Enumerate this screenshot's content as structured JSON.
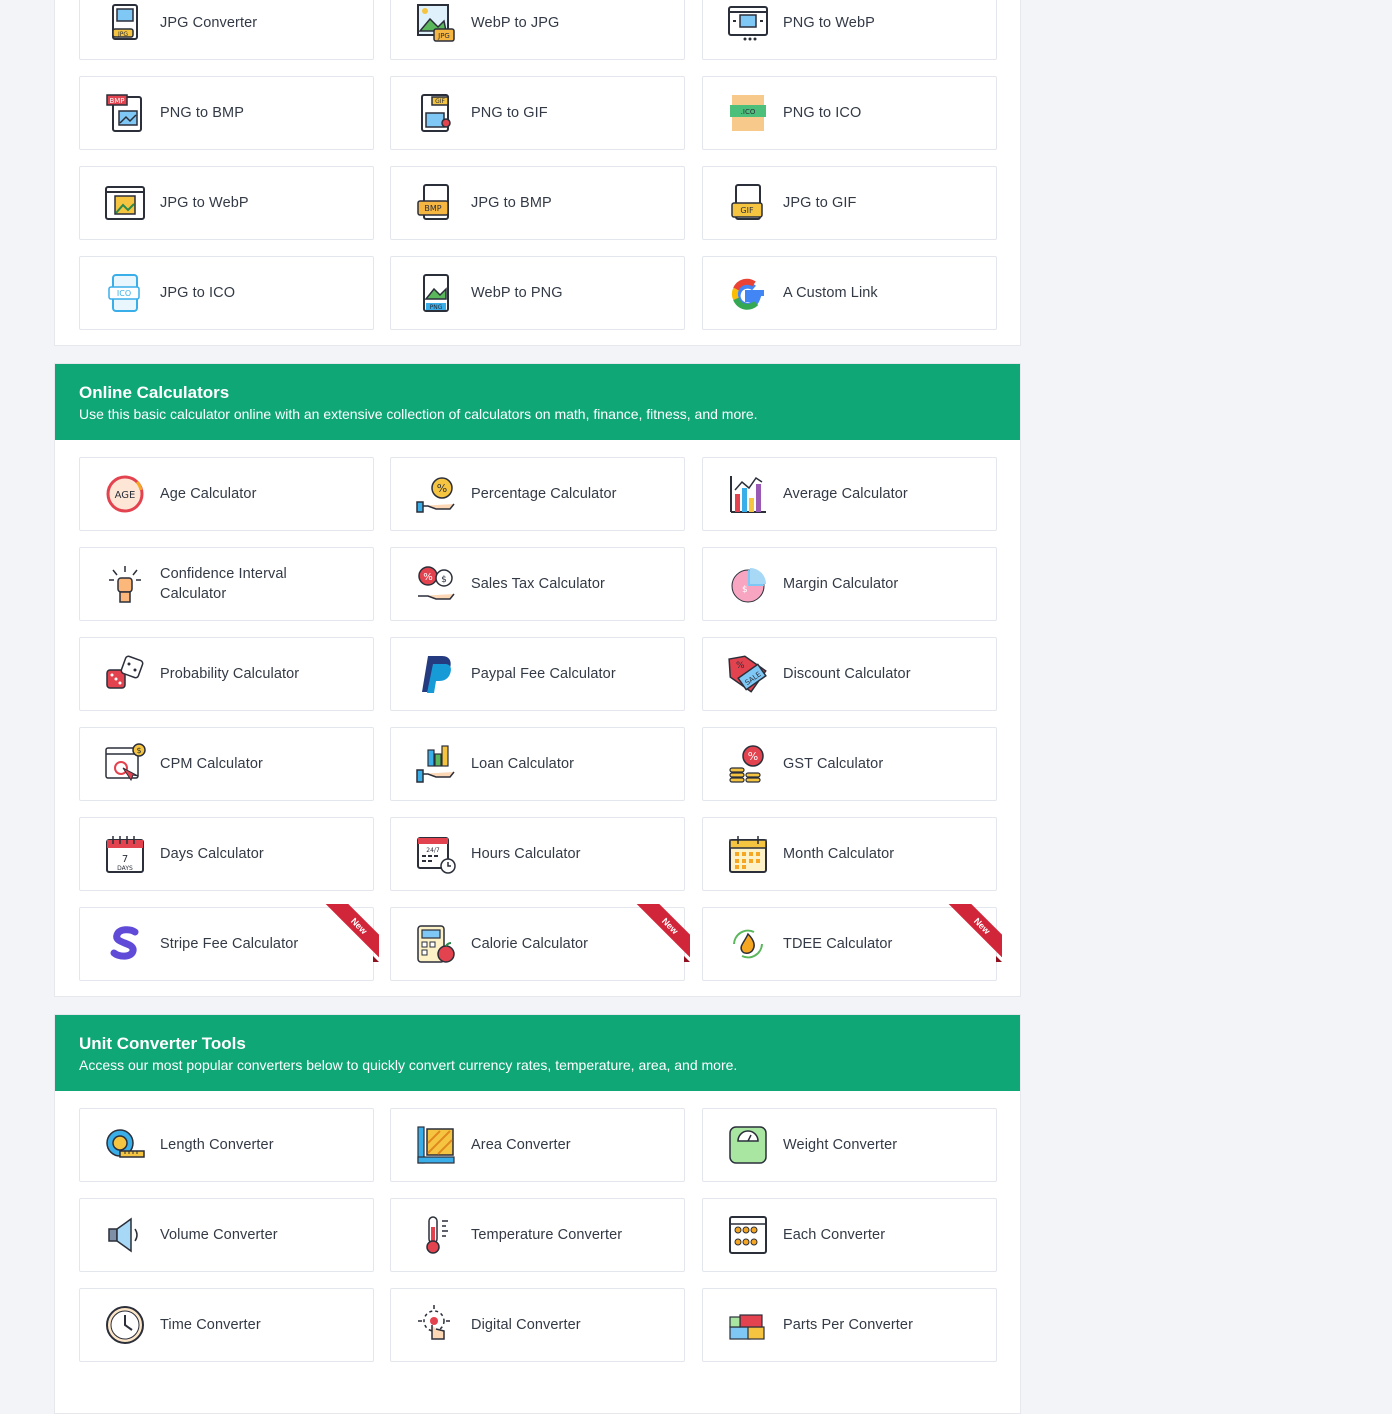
{
  "image_tools": {
    "cards": [
      {
        "label": "JPG Converter",
        "icon": "jpg-file-icon"
      },
      {
        "label": "WebP to JPG",
        "icon": "webp-image-icon"
      },
      {
        "label": "PNG to WebP",
        "icon": "browser-image-icon"
      },
      {
        "label": "PNG to BMP",
        "icon": "bmp-file-icon"
      },
      {
        "label": "PNG to GIF",
        "icon": "gif-file-icon"
      },
      {
        "label": "PNG to ICO",
        "icon": "ico-file-icon"
      },
      {
        "label": "JPG to WebP",
        "icon": "browser-picture-icon"
      },
      {
        "label": "JPG to BMP",
        "icon": "bmp-document-icon"
      },
      {
        "label": "JPG to GIF",
        "icon": "gif-document-icon"
      },
      {
        "label": "JPG to ICO",
        "icon": "ico-document-icon"
      },
      {
        "label": "WebP to PNG",
        "icon": "png-file-icon"
      },
      {
        "label": "A Custom Link",
        "icon": "google-g-icon"
      }
    ]
  },
  "calculators": {
    "title": "Online Calculators",
    "subtitle": "Use this basic calculator online with an extensive collection of calculators on math, finance, fitness, and more.",
    "cards": [
      {
        "label": "Age Calculator",
        "icon": "age-badge-icon"
      },
      {
        "label": "Percentage Calculator",
        "icon": "percent-hand-icon"
      },
      {
        "label": "Average Calculator",
        "icon": "bar-chart-icon"
      },
      {
        "label": "Confidence Interval Calculator",
        "icon": "raised-fist-icon"
      },
      {
        "label": "Sales Tax Calculator",
        "icon": "tax-hand-icon"
      },
      {
        "label": "Margin Calculator",
        "icon": "pie-chart-icon"
      },
      {
        "label": "Probability Calculator",
        "icon": "dice-icon"
      },
      {
        "label": "Paypal Fee Calculator",
        "icon": "paypal-icon"
      },
      {
        "label": "Discount Calculator",
        "icon": "sale-tag-icon"
      },
      {
        "label": "CPM Calculator",
        "icon": "ad-click-icon"
      },
      {
        "label": "Loan Calculator",
        "icon": "loan-hand-icon"
      },
      {
        "label": "GST Calculator",
        "icon": "coins-percent-icon"
      },
      {
        "label": "Days Calculator",
        "icon": "calendar-days-icon"
      },
      {
        "label": "Hours Calculator",
        "icon": "calendar-clock-icon"
      },
      {
        "label": "Month Calculator",
        "icon": "calendar-month-icon"
      },
      {
        "label": "Stripe Fee Calculator",
        "icon": "stripe-s-icon",
        "badge": "New"
      },
      {
        "label": "Calorie Calculator",
        "icon": "calculator-apple-icon",
        "badge": "New"
      },
      {
        "label": "TDEE Calculator",
        "icon": "flame-cycle-icon",
        "badge": "New"
      }
    ]
  },
  "unit_converters": {
    "title": "Unit Converter Tools",
    "subtitle": "Access our most popular converters below to quickly convert currency rates, temperature, area, and more.",
    "cards": [
      {
        "label": "Length Converter",
        "icon": "tape-measure-icon"
      },
      {
        "label": "Area Converter",
        "icon": "area-ruler-icon"
      },
      {
        "label": "Weight Converter",
        "icon": "scale-icon"
      },
      {
        "label": "Volume Converter",
        "icon": "speaker-icon"
      },
      {
        "label": "Temperature Converter",
        "icon": "thermometer-icon"
      },
      {
        "label": "Each Converter",
        "icon": "crate-icon"
      },
      {
        "label": "Time Converter",
        "icon": "clock-icon"
      },
      {
        "label": "Digital Converter",
        "icon": "touch-hand-icon"
      },
      {
        "label": "Parts Per Converter",
        "icon": "blocks-icon"
      }
    ]
  },
  "colors": {
    "accent": "#0fa776",
    "ribbon": "#d1263a"
  }
}
